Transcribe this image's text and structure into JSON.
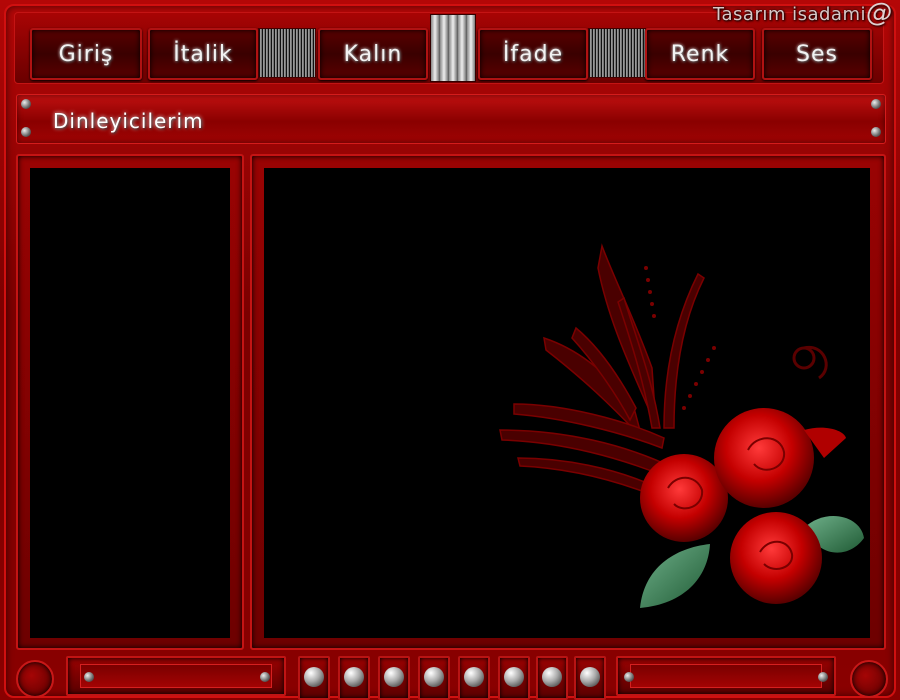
{
  "header": {
    "credit": "Tasarım isadami"
  },
  "toolbar": {
    "buttons": [
      {
        "label": "Giriş"
      },
      {
        "label": "İtalik"
      },
      {
        "label": "Kalın"
      },
      {
        "label": "İfade"
      },
      {
        "label": "Renk"
      },
      {
        "label": "Ses"
      }
    ]
  },
  "section": {
    "title": "Dinleyicilerim"
  },
  "colors": {
    "frame_red": "#8a0000",
    "accent_red": "#c41414",
    "panel_black": "#000000"
  },
  "icons": {
    "credit": "at-sign-icon",
    "decoration": "red-roses-icon"
  }
}
